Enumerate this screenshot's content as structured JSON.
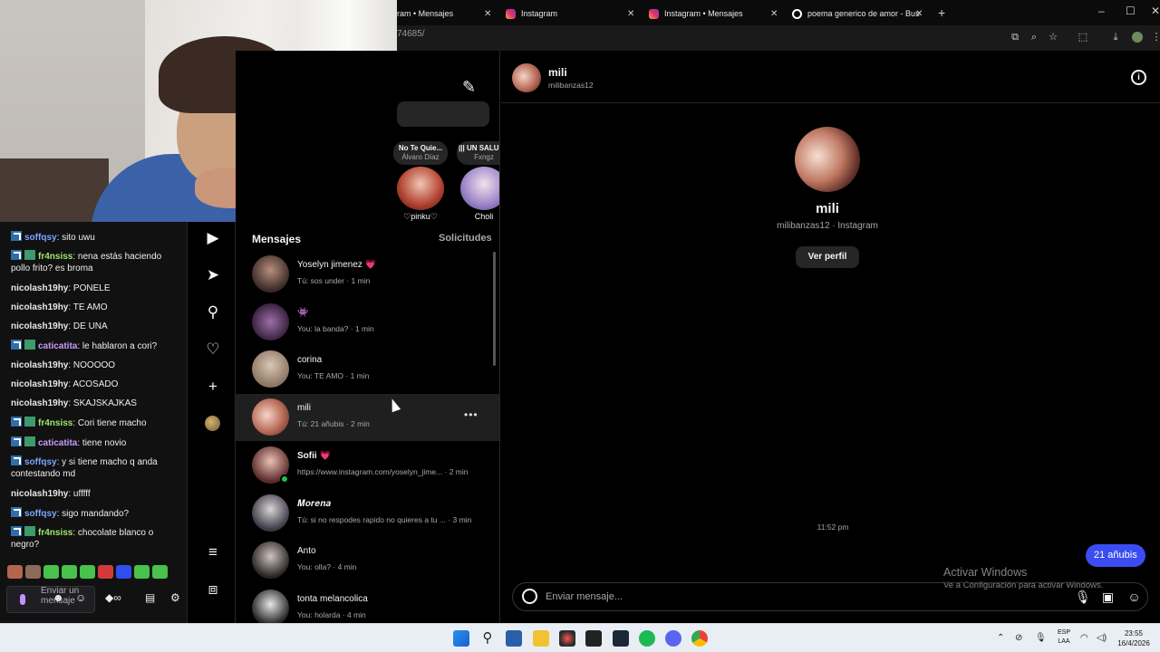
{
  "browser": {
    "tabs": [
      {
        "title": "ram • Mensajes",
        "icon": "instagram-icon"
      },
      {
        "title": "Instagram",
        "icon": "instagram-icon"
      },
      {
        "title": "Instagram • Mensajes",
        "icon": "instagram-icon"
      },
      {
        "title": "poema generico de amor - Bus",
        "icon": "google-icon"
      }
    ],
    "new_tab": "+",
    "address": "74685/",
    "window_controls": {
      "minimize": "–",
      "maximize": "☐",
      "close": "✕"
    }
  },
  "chat": {
    "messages": [
      {
        "user": "soffqsy",
        "text": ": sito uwu",
        "color": "#7aa7ff",
        "badges": 1
      },
      {
        "user": "fr4nsiss",
        "text": ": nena estás haciendo pollo frito? es broma",
        "color": "#9ee86e",
        "badges": 2
      },
      {
        "user": "nicolash19hy",
        "text": ": PONELE",
        "color": "#e8e8e8",
        "badges": 0
      },
      {
        "user": "nicolash19hy",
        "text": ": TE AMO",
        "color": "#e8e8e8",
        "badges": 0
      },
      {
        "user": "nicolash19hy",
        "text": ": DE UNA",
        "color": "#e8e8e8",
        "badges": 0
      },
      {
        "user": "caticatita",
        "text": ": le hablaron a cori?",
        "color": "#c99bff",
        "badges": 2
      },
      {
        "user": "nicolash19hy",
        "text": ": NOOOOO",
        "color": "#e8e8e8",
        "badges": 0
      },
      {
        "user": "nicolash19hy",
        "text": ": ACOSADO",
        "color": "#e8e8e8",
        "badges": 0
      },
      {
        "user": "nicolash19hy",
        "text": ": SKAJSKAJKAS",
        "color": "#e8e8e8",
        "badges": 0
      },
      {
        "user": "fr4nsiss",
        "text": ": Cori tiene macho",
        "color": "#9ee86e",
        "badges": 2
      },
      {
        "user": "caticatita",
        "text": ": tiene novio",
        "color": "#c99bff",
        "badges": 2
      },
      {
        "user": "soffqsy",
        "text": ": y si tiene macho q anda contestando md",
        "color": "#7aa7ff",
        "badges": 1
      },
      {
        "user": "nicolash19hy",
        "text": ": ufffff",
        "color": "#e8e8e8",
        "badges": 0
      },
      {
        "user": "soffqsy",
        "text": ": sigo mandando?",
        "color": "#7aa7ff",
        "badges": 1
      },
      {
        "user": "fr4nsiss",
        "text": ": chocolate blanco o negro?",
        "color": "#9ee86e",
        "badges": 2
      }
    ],
    "input_placeholder": "Enviar un mensaje",
    "emote_colors": [
      "#b5654e",
      "#8e6a5a",
      "#47c24a",
      "#47c24a",
      "#47c24a",
      "#d23a3a",
      "#2f4ef0",
      "#47c24a",
      "#47c24a"
    ]
  },
  "notes": [
    {
      "song": "No Te Quie...",
      "artist": "Álvaro Díaz",
      "name": "♡pinku♡"
    },
    {
      "song": "||| UN SALUD...",
      "artist": "Fxngz",
      "name": "Choli"
    }
  ],
  "inbox": {
    "title": "Mensajes",
    "requests": "Solicitudes",
    "threads": [
      {
        "name": "Yoselyn jimenez 💗",
        "preview": "Tú: sos under · 1 min",
        "style": "",
        "online": false,
        "active": false
      },
      {
        "name": "👾",
        "preview": "You: la banda? · 1 min",
        "style": "",
        "online": false,
        "active": false
      },
      {
        "name": "corina",
        "preview": "You: TE AMO · 1 min",
        "style": "",
        "online": false,
        "active": false
      },
      {
        "name": "mili",
        "preview": "Tú: 21 añubis · 2 min",
        "style": "",
        "online": false,
        "active": true
      },
      {
        "name": "Sofii 💗",
        "preview": "https://www.instagram.com/yoselyn_jime... · 2 min",
        "style": "bold",
        "online": true,
        "active": false
      },
      {
        "name": "𝑴𝒐𝒓𝒆𝒏𝒂",
        "preview": "Tú: si no respodes rapido no quieres a tu ... · 3 min",
        "style": "",
        "online": false,
        "active": false
      },
      {
        "name": "Anto",
        "preview": "You: olla? · 4 min",
        "style": "",
        "online": false,
        "active": false
      },
      {
        "name": "tonta melancolica",
        "preview": "You: holarda · 4 min",
        "style": "",
        "online": false,
        "active": false
      }
    ]
  },
  "conversation": {
    "name": "mili",
    "username": "milibanzas12",
    "profile_name": "mili",
    "profile_sub": "milibanzas12 · Instagram",
    "profile_button": "Ver perfil",
    "timestamp": "11:52 pm",
    "outgoing_message": "21 añubis",
    "input_placeholder": "Enviar mensaje...",
    "accent": "#3b4df2"
  },
  "watermark": {
    "title": "Activar Windows",
    "subtitle": "Ve a Configuración para activar Windows."
  },
  "taskbar": {
    "lang": [
      "ESP",
      "LAA"
    ],
    "time": "23:55",
    "date": "16/4/2026"
  }
}
